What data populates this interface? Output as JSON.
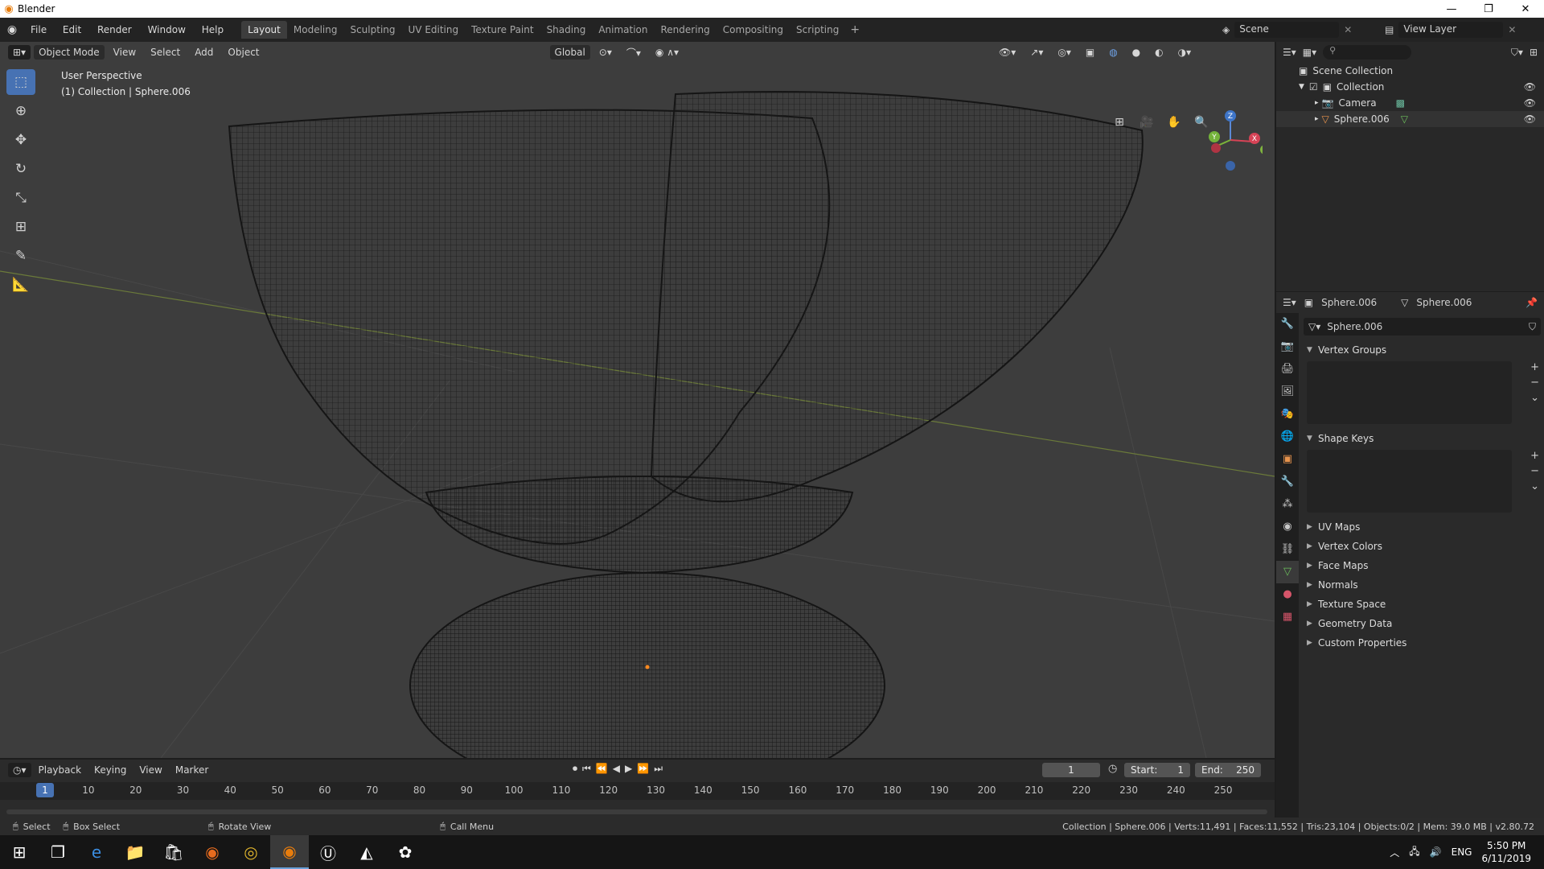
{
  "window": {
    "title": "Blender",
    "controls": [
      "—",
      "❐",
      "✕"
    ]
  },
  "menubar": {
    "menus": [
      "File",
      "Edit",
      "Render",
      "Window",
      "Help"
    ],
    "workspaces": [
      "Layout",
      "Modeling",
      "Sculpting",
      "UV Editing",
      "Texture Paint",
      "Shading",
      "Animation",
      "Rendering",
      "Compositing",
      "Scripting"
    ],
    "active_workspace": "Layout",
    "scene": "Scene",
    "view_layer": "View Layer"
  },
  "viewport": {
    "mode": "Object Mode",
    "menus": [
      "View",
      "Select",
      "Add",
      "Object"
    ],
    "orientation": "Global",
    "perspective": "User Perspective",
    "context": "(1) Collection | Sphere.006",
    "gizmo_axes": {
      "z": "Z",
      "y": "Y",
      "x": "X"
    }
  },
  "outliner": {
    "root": "Scene Collection",
    "items": [
      {
        "label": "Collection"
      },
      {
        "label": "Camera"
      },
      {
        "label": "Sphere.006"
      }
    ]
  },
  "properties": {
    "object_name": "Sphere.006",
    "data_name": "Sphere.006",
    "mesh_name": "Sphere.006",
    "panels_open": [
      "Vertex Groups",
      "Shape Keys"
    ],
    "panels_closed": [
      "UV Maps",
      "Vertex Colors",
      "Face Maps",
      "Normals",
      "Texture Space",
      "Geometry Data",
      "Custom Properties"
    ]
  },
  "timeline": {
    "menus": [
      "Playback",
      "Keying",
      "View",
      "Marker"
    ],
    "current_frame": "1",
    "start_label": "Start:",
    "start": "1",
    "end_label": "End:",
    "end": "250",
    "ruler": [
      "1",
      "10",
      "20",
      "30",
      "40",
      "50",
      "60",
      "70",
      "80",
      "90",
      "100",
      "110",
      "120",
      "130",
      "140",
      "150",
      "160",
      "170",
      "180",
      "190",
      "200",
      "210",
      "220",
      "230",
      "240",
      "250"
    ]
  },
  "statusbar": {
    "select": "Select",
    "box_select": "Box Select",
    "rotate_view": "Rotate View",
    "call_menu": "Call Menu",
    "stats": "Collection | Sphere.006 | Verts:11,491 | Faces:11,552 | Tris:23,104 | Objects:0/2 | Mem: 39.0 MB | v2.80.72"
  },
  "taskbar": {
    "lang": "ENG",
    "time": "5:50 PM",
    "date": "6/11/2019"
  }
}
